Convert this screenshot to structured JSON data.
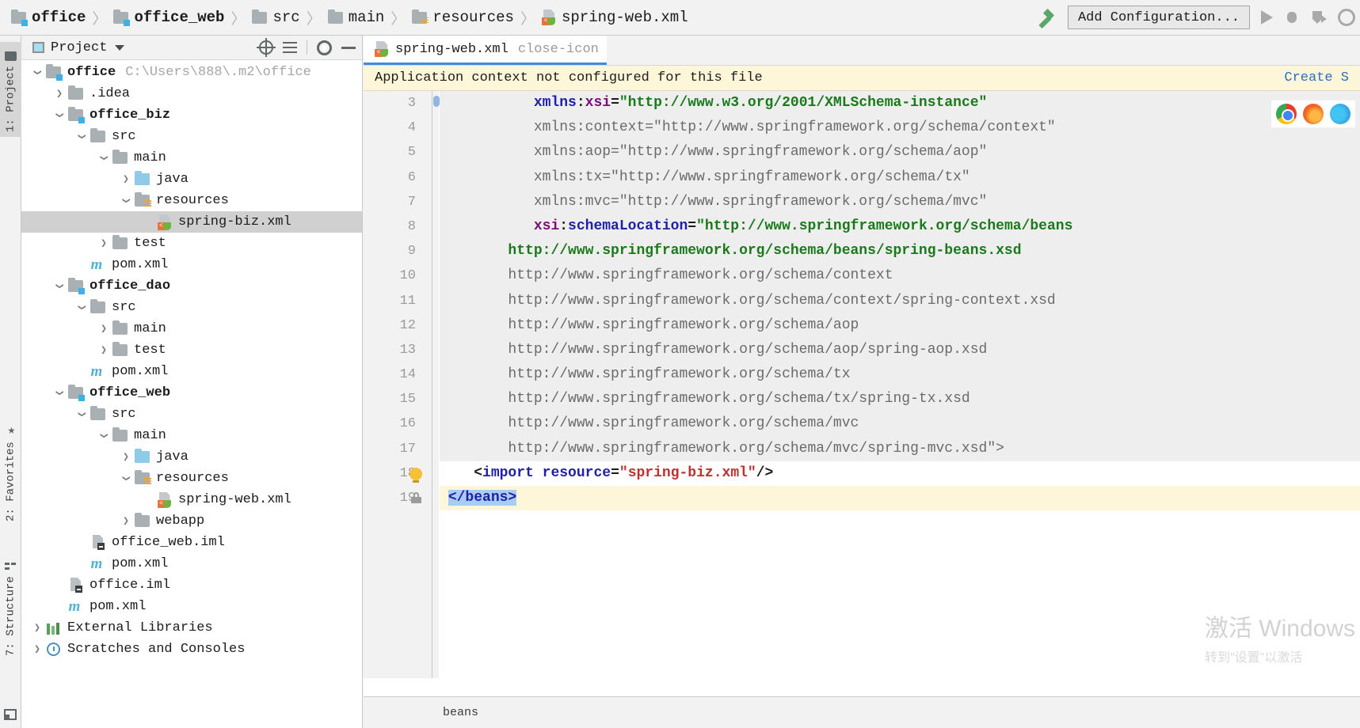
{
  "window": {
    "breadcrumbs": [
      {
        "label": "office",
        "icon": "module-folder-icon",
        "bold": true
      },
      {
        "label": "office_web",
        "icon": "module-folder-icon",
        "bold": true
      },
      {
        "label": "src",
        "icon": "folder-icon",
        "bold": false
      },
      {
        "label": "main",
        "icon": "folder-icon",
        "bold": false
      },
      {
        "label": "resources",
        "icon": "resources-folder-icon",
        "bold": false
      },
      {
        "label": "spring-web.xml",
        "icon": "spring-xml-file-icon",
        "bold": false
      }
    ],
    "separator": "〉"
  },
  "toolbar": {
    "build_icon": "hammer-icon",
    "add_configuration_label": "Add Configuration...",
    "run_icon": "run-icon",
    "debug_icon": "debug-icon",
    "run_coverage_icon": "run-with-coverage-icon",
    "more_icon": "circle-icon"
  },
  "tool_strip": {
    "items": [
      {
        "label": "1: Project",
        "icon": "project-icon",
        "active": true
      },
      {
        "label": "2: Favorites",
        "icon": "star-icon",
        "active": false
      },
      {
        "label": "7: Structure",
        "icon": "structure-icon",
        "active": false
      }
    ],
    "bottom_icon": "terminal-icon"
  },
  "project_panel": {
    "title": "Project",
    "title_icon": "project-window-icon",
    "dropdown_icon": "chevron-down-icon",
    "actions": [
      {
        "name": "scroll-from-source-icon"
      },
      {
        "name": "collapse-all-icon"
      },
      {
        "name": "settings-gear-icon"
      },
      {
        "name": "hide-panel-icon"
      }
    ],
    "tree": [
      {
        "depth": 0,
        "arrow": "down",
        "icon": "module-folder-icon",
        "label": "office",
        "bold": true,
        "path": "C:\\Users\\888\\.m2\\office",
        "selected": false
      },
      {
        "depth": 1,
        "arrow": "right",
        "icon": "folder-icon",
        "label": ".idea",
        "bold": false,
        "path": "",
        "selected": false
      },
      {
        "depth": 1,
        "arrow": "down",
        "icon": "module-folder-icon",
        "label": "office_biz",
        "bold": true,
        "path": "",
        "selected": false
      },
      {
        "depth": 2,
        "arrow": "down",
        "icon": "folder-icon",
        "label": "src",
        "bold": false,
        "path": "",
        "selected": false
      },
      {
        "depth": 3,
        "arrow": "down",
        "icon": "folder-icon",
        "label": "main",
        "bold": false,
        "path": "",
        "selected": false
      },
      {
        "depth": 4,
        "arrow": "right",
        "icon": "sources-folder-icon",
        "label": "java",
        "bold": false,
        "path": "",
        "selected": false
      },
      {
        "depth": 4,
        "arrow": "down",
        "icon": "resources-folder-icon",
        "label": "resources",
        "bold": false,
        "path": "",
        "selected": false
      },
      {
        "depth": 5,
        "arrow": "none",
        "icon": "spring-xml-file-icon",
        "label": "spring-biz.xml",
        "bold": false,
        "path": "",
        "selected": true
      },
      {
        "depth": 3,
        "arrow": "right",
        "icon": "folder-icon",
        "label": "test",
        "bold": false,
        "path": "",
        "selected": false
      },
      {
        "depth": 2,
        "arrow": "none",
        "icon": "maven-icon",
        "label": "pom.xml",
        "bold": false,
        "path": "",
        "selected": false
      },
      {
        "depth": 1,
        "arrow": "down",
        "icon": "module-folder-icon",
        "label": "office_dao",
        "bold": true,
        "path": "",
        "selected": false
      },
      {
        "depth": 2,
        "arrow": "down",
        "icon": "folder-icon",
        "label": "src",
        "bold": false,
        "path": "",
        "selected": false
      },
      {
        "depth": 3,
        "arrow": "right",
        "icon": "folder-icon",
        "label": "main",
        "bold": false,
        "path": "",
        "selected": false
      },
      {
        "depth": 3,
        "arrow": "right",
        "icon": "folder-icon",
        "label": "test",
        "bold": false,
        "path": "",
        "selected": false
      },
      {
        "depth": 2,
        "arrow": "none",
        "icon": "maven-icon",
        "label": "pom.xml",
        "bold": false,
        "path": "",
        "selected": false
      },
      {
        "depth": 1,
        "arrow": "down",
        "icon": "module-folder-icon",
        "label": "office_web",
        "bold": true,
        "path": "",
        "selected": false
      },
      {
        "depth": 2,
        "arrow": "down",
        "icon": "folder-icon",
        "label": "src",
        "bold": false,
        "path": "",
        "selected": false
      },
      {
        "depth": 3,
        "arrow": "down",
        "icon": "folder-icon",
        "label": "main",
        "bold": false,
        "path": "",
        "selected": false
      },
      {
        "depth": 4,
        "arrow": "right",
        "icon": "sources-folder-icon",
        "label": "java",
        "bold": false,
        "path": "",
        "selected": false
      },
      {
        "depth": 4,
        "arrow": "down",
        "icon": "resources-folder-icon",
        "label": "resources",
        "bold": false,
        "path": "",
        "selected": false
      },
      {
        "depth": 5,
        "arrow": "none",
        "icon": "spring-xml-file-icon",
        "label": "spring-web.xml",
        "bold": false,
        "path": "",
        "selected": false
      },
      {
        "depth": 4,
        "arrow": "right",
        "icon": "folder-icon",
        "label": "webapp",
        "bold": false,
        "path": "",
        "selected": false
      },
      {
        "depth": 2,
        "arrow": "none",
        "icon": "iml-file-icon",
        "label": "office_web.iml",
        "bold": false,
        "path": "",
        "selected": false
      },
      {
        "depth": 2,
        "arrow": "none",
        "icon": "maven-icon",
        "label": "pom.xml",
        "bold": false,
        "path": "",
        "selected": false
      },
      {
        "depth": 1,
        "arrow": "none",
        "icon": "iml-file-icon",
        "label": "office.iml",
        "bold": false,
        "path": "",
        "selected": false
      },
      {
        "depth": 1,
        "arrow": "none",
        "icon": "maven-icon",
        "label": "pom.xml",
        "bold": false,
        "path": "",
        "selected": false
      },
      {
        "depth": 0,
        "arrow": "right",
        "icon": "external-libraries-icon",
        "label": "External Libraries",
        "bold": false,
        "path": "",
        "selected": false
      },
      {
        "depth": 0,
        "arrow": "right",
        "icon": "scratches-icon",
        "label": "Scratches and Consoles",
        "bold": false,
        "path": "",
        "selected": false
      }
    ]
  },
  "editor": {
    "tab": {
      "label": "spring-web.xml",
      "icon": "spring-xml-file-icon",
      "close_icon": "close-icon"
    },
    "notification": {
      "message": "Application context not configured for this file",
      "action_label": "Create S"
    },
    "browser_preview_icons": [
      "chrome-icon",
      "firefox-icon",
      "edge-icon"
    ],
    "first_line_number": 3,
    "lines": [
      {
        "n": 3,
        "shaded": true,
        "indent": 11,
        "segments": [
          {
            "t": "xmlns",
            "c": "tk-attr"
          },
          {
            "t": ":",
            "c": "tk-eq"
          },
          {
            "t": "xsi",
            "c": "tk-ns"
          },
          {
            "t": "=",
            "c": "tk-eq"
          },
          {
            "t": "\"http://www.w3.org/2001/XMLSchema-instance\"",
            "c": "tk-val"
          }
        ]
      },
      {
        "n": 4,
        "shaded": true,
        "indent": 11,
        "segments": [
          {
            "t": "xmlns:context=\"http://www.springframework.org/schema/context\"",
            "c": "tk-gray"
          }
        ]
      },
      {
        "n": 5,
        "shaded": true,
        "indent": 11,
        "segments": [
          {
            "t": "xmlns:aop=\"http://www.springframework.org/schema/aop\"",
            "c": "tk-gray"
          }
        ]
      },
      {
        "n": 6,
        "shaded": true,
        "indent": 11,
        "segments": [
          {
            "t": "xmlns:tx=\"http://www.springframework.org/schema/tx\"",
            "c": "tk-gray"
          }
        ]
      },
      {
        "n": 7,
        "shaded": true,
        "indent": 11,
        "segments": [
          {
            "t": "xmlns:mvc=\"http://www.springframework.org/schema/mvc\"",
            "c": "tk-gray"
          }
        ]
      },
      {
        "n": 8,
        "shaded": true,
        "indent": 11,
        "segments": [
          {
            "t": "xsi",
            "c": "tk-ns"
          },
          {
            "t": ":",
            "c": "tk-eq"
          },
          {
            "t": "schemaLocation",
            "c": "tk-attr"
          },
          {
            "t": "=",
            "c": "tk-eq"
          },
          {
            "t": "\"http://www.springframework.org/schema/beans",
            "c": "tk-val"
          }
        ]
      },
      {
        "n": 9,
        "shaded": true,
        "indent": 8,
        "segments": [
          {
            "t": "http://www.springframework.org/schema/beans/spring-beans.xsd",
            "c": "tk-val"
          }
        ]
      },
      {
        "n": 10,
        "shaded": true,
        "indent": 8,
        "segments": [
          {
            "t": "http://www.springframework.org/schema/context",
            "c": "tk-gray"
          }
        ]
      },
      {
        "n": 11,
        "shaded": true,
        "indent": 8,
        "segments": [
          {
            "t": "http://www.springframework.org/schema/context/spring-context.xsd",
            "c": "tk-gray"
          }
        ]
      },
      {
        "n": 12,
        "shaded": true,
        "indent": 8,
        "segments": [
          {
            "t": "http://www.springframework.org/schema/aop",
            "c": "tk-gray"
          }
        ]
      },
      {
        "n": 13,
        "shaded": true,
        "indent": 8,
        "segments": [
          {
            "t": "http://www.springframework.org/schema/aop/spring-aop.xsd",
            "c": "tk-gray"
          }
        ]
      },
      {
        "n": 14,
        "shaded": true,
        "indent": 8,
        "segments": [
          {
            "t": "http://www.springframework.org/schema/tx",
            "c": "tk-gray"
          }
        ]
      },
      {
        "n": 15,
        "shaded": true,
        "indent": 8,
        "segments": [
          {
            "t": "http://www.springframework.org/schema/tx/spring-tx.xsd",
            "c": "tk-gray"
          }
        ]
      },
      {
        "n": 16,
        "shaded": true,
        "indent": 8,
        "segments": [
          {
            "t": "http://www.springframework.org/schema/mvc",
            "c": "tk-gray"
          }
        ]
      },
      {
        "n": 17,
        "shaded": true,
        "indent": 8,
        "segments": [
          {
            "t": "http://www.springframework.org/schema/mvc/spring-mvc.xsd\">",
            "c": "tk-gray"
          }
        ]
      },
      {
        "n": 18,
        "shaded": false,
        "indent": 4,
        "gutter_icon": "intention-bulb-icon",
        "segments": [
          {
            "t": "<",
            "c": "tk-eq"
          },
          {
            "t": "import",
            "c": "tk-tag"
          },
          {
            "t": " ",
            "c": "tk-gray"
          },
          {
            "t": "resource",
            "c": "tk-attr"
          },
          {
            "t": "=",
            "c": "tk-eq"
          },
          {
            "t": "\"spring-biz.xml\"",
            "c": "tk-str"
          },
          {
            "t": "/>",
            "c": "tk-eq"
          }
        ]
      },
      {
        "n": 19,
        "shaded": false,
        "highlight": true,
        "indent": 1,
        "gutter_icon": "fold-lock-icon",
        "segments": [
          {
            "t": "</beans>",
            "c": "tk-tag tk-selbg"
          }
        ]
      }
    ],
    "status_breadcrumb": "beans"
  },
  "watermark": {
    "line1": "激活 Windows",
    "line2": "转到\"设置\"以激活"
  }
}
